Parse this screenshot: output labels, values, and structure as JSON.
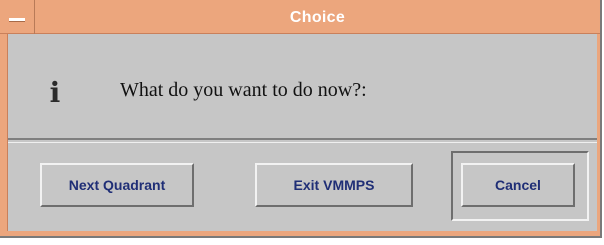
{
  "window": {
    "title": "Choice",
    "system_menu_icon": "window-menu-icon"
  },
  "dialog": {
    "icon": "info-icon",
    "icon_glyph": "ℹ",
    "message": "What do you want to do now?:"
  },
  "buttons": {
    "next_quadrant": "Next Quadrant",
    "exit_vmmps": "Exit VMMPS",
    "cancel": "Cancel"
  },
  "colors": {
    "titlebar": "#eca67d",
    "dialog_bg": "#c6c6c6",
    "button_text": "#1f2e76"
  }
}
